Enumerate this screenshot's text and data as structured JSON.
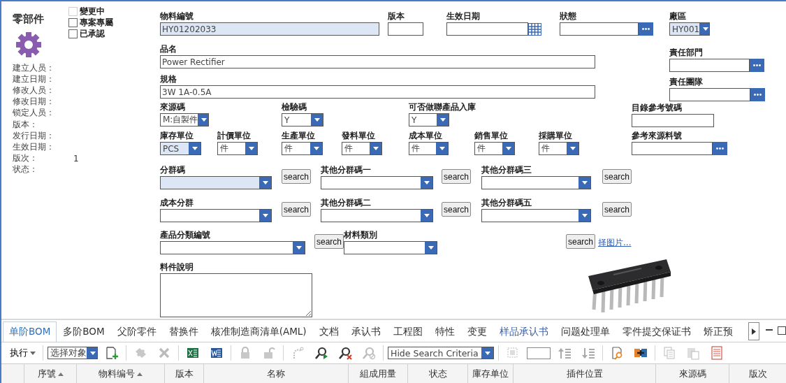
{
  "title": "零部件",
  "checkboxes": [
    {
      "label": "變更中",
      "checked": false,
      "disabled": true
    },
    {
      "label": "專案專屬",
      "checked": false,
      "disabled": false
    },
    {
      "label": "已承認",
      "checked": false,
      "disabled": false
    }
  ],
  "info": [
    {
      "label": "建立人员："
    },
    {
      "label": "建立日期："
    },
    {
      "label": "修改人员："
    },
    {
      "label": "修改日期："
    },
    {
      "label": "锁定人员："
    },
    {
      "label": "版本："
    },
    {
      "label": "发行日期："
    },
    {
      "label": "生效日期："
    },
    {
      "label": "版次：",
      "value": "1"
    },
    {
      "label": "状态："
    }
  ],
  "form": {
    "rows": [
      {
        "fields": [
          {
            "label": "物料編號",
            "kind": "text",
            "value": "HY01202033",
            "highlighted": true
          },
          {
            "label": "版本",
            "kind": "text",
            "highlighted": false
          },
          {
            "label": "生效日期",
            "kind": "date"
          },
          {
            "label": "狀態",
            "kind": "lookup"
          }
        ]
      },
      {
        "fields": [
          {
            "label": "品名",
            "kind": "text",
            "value": "Power Rectifier",
            "highlighted": false
          }
        ]
      },
      {
        "fields": [
          {
            "label": "規格",
            "kind": "text",
            "value": "3W 1A-0.5A",
            "highlighted": false
          }
        ]
      },
      {
        "fields": [
          {
            "label": "來源碼",
            "kind": "select",
            "value": "M:自製件",
            "highlighted": false
          },
          {
            "label": "檢驗碼",
            "kind": "select",
            "value": "Y",
            "highlighted": false
          },
          {
            "label": "可否做聯產品入庫",
            "kind": "select",
            "value": "Y",
            "highlighted": false
          }
        ]
      },
      {
        "fields": [
          {
            "label": "庫存單位",
            "kind": "select",
            "value": "PCS",
            "highlighted": true
          },
          {
            "label": "計價單位",
            "kind": "select",
            "value": "件",
            "highlighted": false
          },
          {
            "label": "生產單位",
            "kind": "select",
            "value": "件",
            "highlighted": false
          },
          {
            "label": "發料單位",
            "kind": "select",
            "value": "件",
            "highlighted": false
          },
          {
            "label": "成本單位",
            "kind": "select",
            "value": "件",
            "highlighted": false
          },
          {
            "label": "銷售單位",
            "kind": "select",
            "value": "件",
            "highlighted": false
          },
          {
            "label": "採購單位",
            "kind": "select",
            "value": "件",
            "highlighted": false
          }
        ]
      },
      {
        "fields": [
          {
            "label": "分群碼",
            "kind": "select",
            "highlighted": true
          },
          {
            "kind": "search",
            "text": "search"
          },
          {
            "label": "其他分群碼一",
            "kind": "select",
            "highlighted": false
          },
          {
            "kind": "search",
            "text": "search"
          },
          {
            "label": "其他分群碼三",
            "kind": "select",
            "highlighted": false
          },
          {
            "kind": "search",
            "text": "search"
          }
        ]
      },
      {
        "fields": [
          {
            "label": "成本分群",
            "kind": "select",
            "highlighted": false
          },
          {
            "kind": "search",
            "text": "search"
          },
          {
            "label": "其他分群碼二",
            "kind": "select",
            "highlighted": false
          },
          {
            "kind": "search",
            "text": "search"
          },
          {
            "label": "其他分群碼五",
            "kind": "select",
            "highlighted": false
          },
          {
            "kind": "search",
            "text": "search"
          }
        ]
      },
      {
        "fields": [
          {
            "label": "產品分類編號",
            "kind": "select",
            "highlighted": false
          },
          {
            "kind": "search",
            "text": "search"
          },
          {
            "label": "材料類別",
            "kind": "select",
            "highlighted": false
          },
          {
            "kind": "search",
            "text": "search"
          },
          {
            "kind": "link",
            "text": "择图片..."
          }
        ]
      },
      {
        "fields": [
          {
            "label": "料件說明",
            "kind": "textarea"
          },
          {
            "kind": "picture"
          }
        ]
      }
    ],
    "right": [
      {
        "label": "廠區",
        "kind": "select",
        "value": "HY001",
        "highlighted": true
      },
      {
        "label": "責任部門",
        "kind": "lookup"
      },
      {
        "label": "責任團隊",
        "kind": "lookup"
      },
      {
        "label": "目錄參考號碼",
        "kind": "text",
        "highlighted": false
      },
      {
        "label": "參考來源料號",
        "kind": "lookup"
      }
    ]
  },
  "tabs": [
    {
      "label": "单阶BOM",
      "selected": true,
      "highlighted": false
    },
    {
      "label": "多阶BOM",
      "selected": false,
      "highlighted": false
    },
    {
      "label": "父阶零件",
      "selected": false,
      "highlighted": false
    },
    {
      "label": "替换件",
      "selected": false,
      "highlighted": false
    },
    {
      "label": "核准制造商清单(AML)",
      "selected": false,
      "highlighted": false
    },
    {
      "label": "文档",
      "selected": false,
      "highlighted": false
    },
    {
      "label": "承认书",
      "selected": false,
      "highlighted": false
    },
    {
      "label": "工程图",
      "selected": false,
      "highlighted": false
    },
    {
      "label": "特性",
      "selected": false,
      "highlighted": false
    },
    {
      "label": "变更",
      "selected": false,
      "highlighted": false
    },
    {
      "label": "样品承认书",
      "selected": false,
      "highlighted": true
    },
    {
      "label": "问题处理单",
      "selected": false,
      "highlighted": false
    },
    {
      "label": "零件提交保证书",
      "selected": false,
      "highlighted": false
    },
    {
      "label": "矫正预",
      "selected": false,
      "highlighted": false
    }
  ],
  "toolbar": {
    "menu": "执行",
    "object_select": "选择对象",
    "icons_left": [
      {
        "disabled": false
      },
      {
        "disabled": true
      },
      {
        "disabled": true
      },
      {
        "disabled": false
      },
      {
        "disabled": false
      },
      {
        "disabled": true
      },
      {
        "disabled": true
      },
      {
        "disabled": true
      },
      {
        "disabled": false
      },
      {
        "disabled": false
      },
      {
        "disabled": true
      }
    ],
    "criteria_select": "Hide Search Criteria",
    "icons_right": [
      {
        "disabled": true
      },
      {
        "disabled": true
      },
      {
        "disabled": true
      },
      {
        "disabled": false
      },
      {
        "disabled": false
      },
      {
        "disabled": true
      },
      {
        "disabled": true
      },
      {
        "disabled": false
      }
    ]
  },
  "table": {
    "columns": [
      {
        "sort_ascending": false
      },
      {
        "label": "序號",
        "sort_ascending": true
      },
      {
        "label": "物料编号",
        "sort_ascending": true
      },
      {
        "label": "版本",
        "sort_ascending": false
      },
      {
        "label": "名称",
        "sort_ascending": false
      },
      {
        "label": "組成用量",
        "sort_ascending": false
      },
      {
        "label": "状态",
        "sort_ascending": false
      },
      {
        "label": "庫存单位",
        "sort_ascending": false
      },
      {
        "label": "插件位置",
        "sort_ascending": false
      },
      {
        "label": "來源碼",
        "sort_ascending": false
      },
      {
        "label": "版次",
        "sort_ascending": false
      }
    ]
  }
}
